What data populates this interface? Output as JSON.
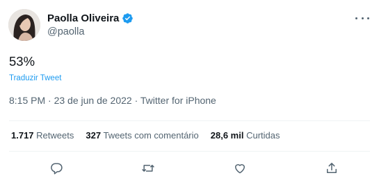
{
  "user": {
    "display_name": "Paolla Oliveira",
    "handle": "@paolla",
    "verified": true
  },
  "tweet": {
    "text": "53%",
    "translate_label": "Traduzir Tweet",
    "time": "8:15 PM",
    "date": "23 de jun de 2022",
    "source": "Twitter for iPhone",
    "separator": "·"
  },
  "stats": {
    "retweets_count": "1.717",
    "retweets_label": "Retweets",
    "quotes_count": "327",
    "quotes_label": "Tweets com comentário",
    "likes_count": "28,6 mil",
    "likes_label": "Curtidas"
  },
  "colors": {
    "accent": "#1d9bf0",
    "text_primary": "#0f1419",
    "text_secondary": "#536471",
    "divider": "#eff3f4"
  },
  "icons": {
    "more": "more-icon",
    "reply": "reply-icon",
    "retweet": "retweet-icon",
    "like": "heart-icon",
    "share": "share-icon",
    "verified": "verified-badge-icon"
  }
}
